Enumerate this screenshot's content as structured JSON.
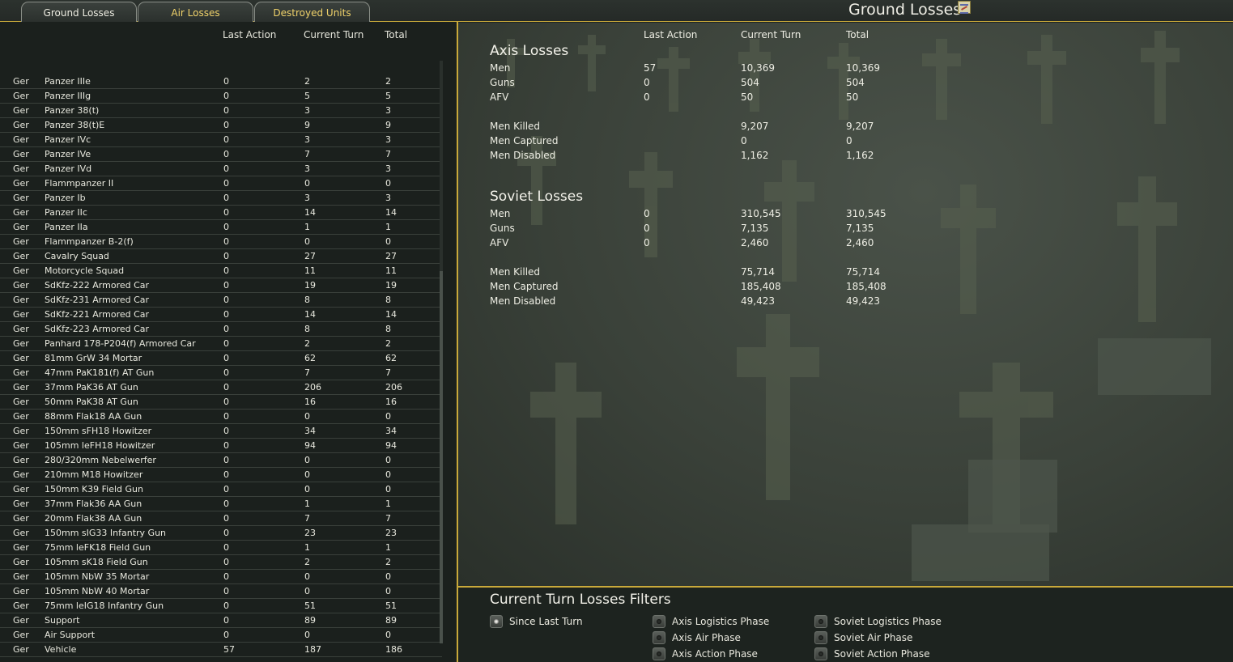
{
  "tabs": [
    {
      "label": "Ground Losses",
      "active": true
    },
    {
      "label": "Air Losses",
      "active": false
    },
    {
      "label": "Destroyed Units",
      "active": false
    }
  ],
  "page_title": "Ground Losses",
  "list_headers": {
    "last_action": "Last Action",
    "current_turn": "Current Turn",
    "total": "Total"
  },
  "units": [
    [
      "Ger",
      "Panzer IIIe",
      "0",
      "2",
      "2"
    ],
    [
      "Ger",
      "Panzer IIIg",
      "0",
      "5",
      "5"
    ],
    [
      "Ger",
      "Panzer 38(t)",
      "0",
      "3",
      "3"
    ],
    [
      "Ger",
      "Panzer 38(t)E",
      "0",
      "9",
      "9"
    ],
    [
      "Ger",
      "Panzer IVc",
      "0",
      "3",
      "3"
    ],
    [
      "Ger",
      "Panzer IVe",
      "0",
      "7",
      "7"
    ],
    [
      "Ger",
      "Panzer IVd",
      "0",
      "3",
      "3"
    ],
    [
      "Ger",
      "Flammpanzer II",
      "0",
      "0",
      "0"
    ],
    [
      "Ger",
      "Panzer Ib",
      "0",
      "3",
      "3"
    ],
    [
      "Ger",
      "Panzer IIc",
      "0",
      "14",
      "14"
    ],
    [
      "Ger",
      "Panzer IIa",
      "0",
      "1",
      "1"
    ],
    [
      "Ger",
      "Flammpanzer B-2(f)",
      "0",
      "0",
      "0"
    ],
    [
      "Ger",
      "Cavalry Squad",
      "0",
      "27",
      "27"
    ],
    [
      "Ger",
      "Motorcycle Squad",
      "0",
      "11",
      "11"
    ],
    [
      "Ger",
      "SdKfz-222 Armored Car",
      "0",
      "19",
      "19"
    ],
    [
      "Ger",
      "SdKfz-231 Armored Car",
      "0",
      "8",
      "8"
    ],
    [
      "Ger",
      "SdKfz-221 Armored Car",
      "0",
      "14",
      "14"
    ],
    [
      "Ger",
      "SdKfz-223 Armored Car",
      "0",
      "8",
      "8"
    ],
    [
      "Ger",
      "Panhard 178-P204(f) Armored Car",
      "0",
      "2",
      "2"
    ],
    [
      "Ger",
      "81mm GrW 34 Mortar",
      "0",
      "62",
      "62"
    ],
    [
      "Ger",
      "47mm PaK181(f) AT Gun",
      "0",
      "7",
      "7"
    ],
    [
      "Ger",
      "37mm PaK36 AT Gun",
      "0",
      "206",
      "206"
    ],
    [
      "Ger",
      "50mm PaK38 AT Gun",
      "0",
      "16",
      "16"
    ],
    [
      "Ger",
      "88mm Flak18 AA Gun",
      "0",
      "0",
      "0"
    ],
    [
      "Ger",
      "150mm sFH18 Howitzer",
      "0",
      "34",
      "34"
    ],
    [
      "Ger",
      "105mm leFH18 Howitzer",
      "0",
      "94",
      "94"
    ],
    [
      "Ger",
      "280/320mm Nebelwerfer",
      "0",
      "0",
      "0"
    ],
    [
      "Ger",
      "210mm M18 Howitzer",
      "0",
      "0",
      "0"
    ],
    [
      "Ger",
      "150mm K39 Field Gun",
      "0",
      "0",
      "0"
    ],
    [
      "Ger",
      "37mm Flak36 AA Gun",
      "0",
      "1",
      "1"
    ],
    [
      "Ger",
      "20mm Flak38 AA Gun",
      "0",
      "7",
      "7"
    ],
    [
      "Ger",
      "150mm sIG33 Infantry Gun",
      "0",
      "23",
      "23"
    ],
    [
      "Ger",
      "75mm leFK18 Field Gun",
      "0",
      "1",
      "1"
    ],
    [
      "Ger",
      "105mm sK18 Field Gun",
      "0",
      "2",
      "2"
    ],
    [
      "Ger",
      "105mm NbW 35 Mortar",
      "0",
      "0",
      "0"
    ],
    [
      "Ger",
      "105mm NbW 40 Mortar",
      "0",
      "0",
      "0"
    ],
    [
      "Ger",
      "75mm leIG18 Infantry Gun",
      "0",
      "51",
      "51"
    ],
    [
      "Ger",
      "Support",
      "0",
      "89",
      "89"
    ],
    [
      "Ger",
      "Air Support",
      "0",
      "0",
      "0"
    ],
    [
      "Ger",
      "Vehicle",
      "57",
      "187",
      "186"
    ]
  ],
  "summary": {
    "headers": {
      "last_action": "Last Action",
      "current_turn": "Current Turn",
      "total": "Total"
    },
    "axis": {
      "title": "Axis Losses",
      "rows": [
        [
          "Men",
          "57",
          "10,369",
          "10,369"
        ],
        [
          "Guns",
          "0",
          "504",
          "504"
        ],
        [
          "AFV",
          "0",
          "50",
          "50"
        ]
      ],
      "detail_rows": [
        [
          "Men Killed",
          "9,207",
          "9,207"
        ],
        [
          "Men Captured",
          "0",
          "0"
        ],
        [
          "Men Disabled",
          "1,162",
          "1,162"
        ]
      ]
    },
    "soviet": {
      "title": "Soviet Losses",
      "rows": [
        [
          "Men",
          "0",
          "310,545",
          "310,545"
        ],
        [
          "Guns",
          "0",
          "7,135",
          "7,135"
        ],
        [
          "AFV",
          "0",
          "2,460",
          "2,460"
        ]
      ],
      "detail_rows": [
        [
          "Men Killed",
          "75,714",
          "75,714"
        ],
        [
          "Men Captured",
          "185,408",
          "185,408"
        ],
        [
          "Men Disabled",
          "49,423",
          "49,423"
        ]
      ]
    }
  },
  "filters": {
    "title": "Current Turn Losses Filters",
    "options": [
      {
        "label": "Since Last Turn",
        "selected": true
      },
      {
        "label": "Axis Logistics Phase",
        "selected": false
      },
      {
        "label": "Axis Air Phase",
        "selected": false
      },
      {
        "label": "Axis Action Phase",
        "selected": false
      },
      {
        "label": "Soviet Logistics Phase",
        "selected": false
      },
      {
        "label": "Soviet Air Phase",
        "selected": false
      },
      {
        "label": "Soviet Action Phase",
        "selected": false
      }
    ]
  },
  "colors": {
    "accent": "#c9a93a",
    "inactive_tab_text": "#f0d26a",
    "panel": "#1b201d"
  }
}
